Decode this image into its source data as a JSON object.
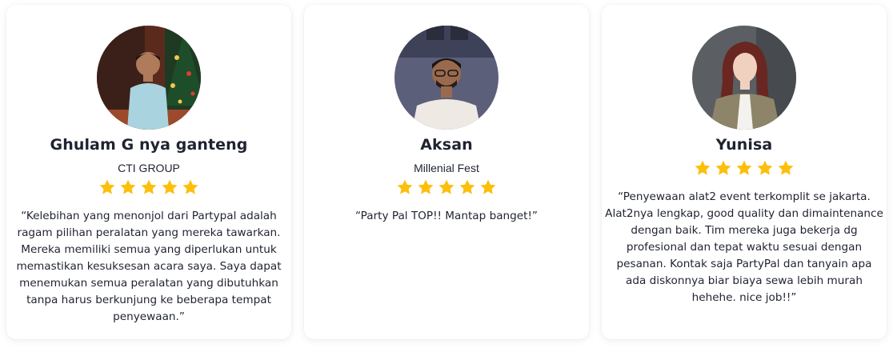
{
  "testimonials": [
    {
      "name": "Ghulam G nya ganteng",
      "company": "CTI GROUP",
      "rating": 5,
      "quote": "“Kelebihan yang menonjol dari Partypal adalah ragam pilihan peralatan yang mereka tawarkan. Mereka memiliki semua yang diperlukan untuk memastikan kesuksesan acara saya. Saya dapat menemukan semua peralatan yang dibutuhkan tanpa harus berkunjung ke beberapa tempat penyewaan.”"
    },
    {
      "name": "Aksan",
      "company": "Millenial Fest",
      "rating": 5,
      "quote": "“Party Pal TOP!! Mantap banget!”"
    },
    {
      "name": "Yunisa",
      "rating": 5,
      "quote": "“Penyewaan alat2 event terkomplit se jakarta. Alat2nya lengkap, good quality dan dimaintenance dengan baik. Tim mereka juga bekerja dg profesional dan tepat waktu sesuai dengan pesanan. Kontak saja PartyPal dan tanyain apa ada diskonnya biar biaya sewa lebih murah hehehe. nice job!!”"
    }
  ],
  "colors": {
    "star": "#fcbf0c",
    "text": "#1f2330",
    "card_bg": "#ffffff"
  },
  "icons": {
    "rating": "star-icon"
  }
}
